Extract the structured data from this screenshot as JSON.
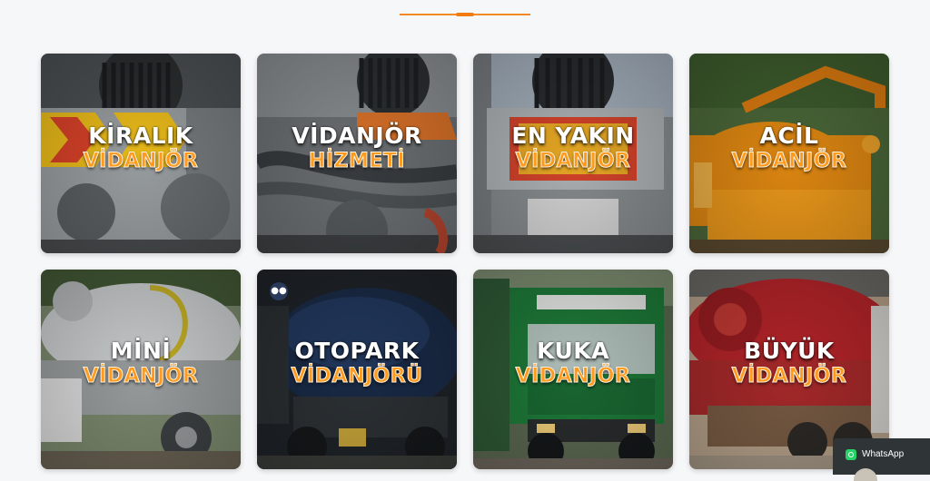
{
  "colors": {
    "accent": "#f08a24",
    "caption_primary": "#ffffff",
    "caption_secondary": "#ff9a1c"
  },
  "services": [
    {
      "line1": "KİRALIK",
      "line2": "VİDANJÖR",
      "image": "vacuum-truck-rear-hose-reels"
    },
    {
      "line1": "VİDANJÖR",
      "line2": "HİZMETİ",
      "image": "vacuum-truck-hoses"
    },
    {
      "line1": "EN YAKIN",
      "line2": "VİDANJÖR",
      "image": "vacuum-truck-rear-tank"
    },
    {
      "line1": "ACİL",
      "line2": "VİDANJÖR",
      "image": "orange-vacuum-truck"
    },
    {
      "line1": "MİNİ",
      "line2": "VİDANJÖR",
      "image": "white-tank-truck"
    },
    {
      "line1": "OTOPARK",
      "line2": "VİDANJÖRÜ",
      "image": "dark-tanker-truck"
    },
    {
      "line1": "KUKA",
      "line2": "VİDANJÖR",
      "image": "green-truck"
    },
    {
      "line1": "BÜYÜK",
      "line2": "VİDANJÖR",
      "image": "red-tank-truck"
    }
  ],
  "whatsapp": {
    "label": "WhatsApp",
    "icon": "whatsapp-icon"
  }
}
